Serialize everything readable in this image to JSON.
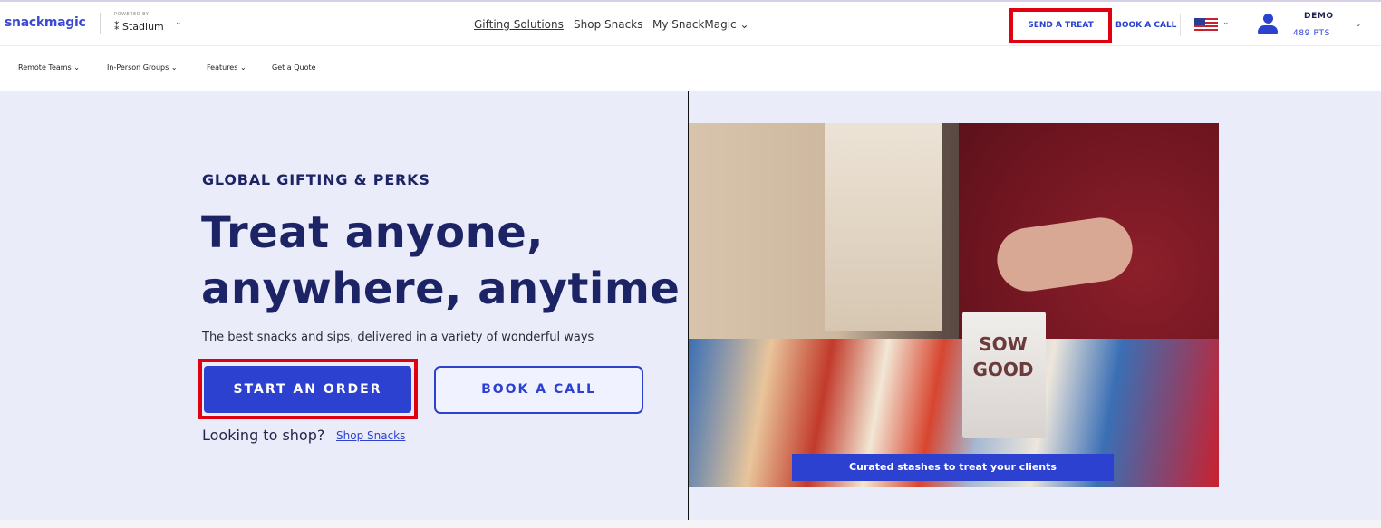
{
  "header": {
    "logo": "snackmagic",
    "powered_by": "POWERED BY",
    "stadium": "Stadium",
    "nav": {
      "gifting": "Gifting Solutions",
      "shop": "Shop Snacks",
      "my": "My SnackMagic"
    },
    "send_treat": "SEND A TREAT",
    "book_call": "BOOK A CALL",
    "user_name": "DEMO",
    "user_points": "489 PTS"
  },
  "subnav": {
    "items": [
      "Remote Teams",
      "In-Person Groups",
      "Features",
      "Get a Quote"
    ]
  },
  "hero": {
    "eyebrow": "GLOBAL GIFTING & PERKS",
    "headline_line1": "Treat anyone,",
    "headline_line2": "anywhere, anytime",
    "subhead": "The best snacks and sips, delivered in a variety of wonderful ways",
    "start_order": "START AN ORDER",
    "book_call": "BOOK A CALL",
    "looking": "Looking to shop?",
    "shop_link": "Shop Snacks",
    "image_caption": "Curated stashes to treat your clients",
    "bag_text": "SOW GOOD"
  },
  "colors": {
    "brand_blue": "#2d41d1",
    "navy": "#1d2466",
    "hero_bg": "#ebecfa",
    "highlight_red": "#e1000f"
  }
}
